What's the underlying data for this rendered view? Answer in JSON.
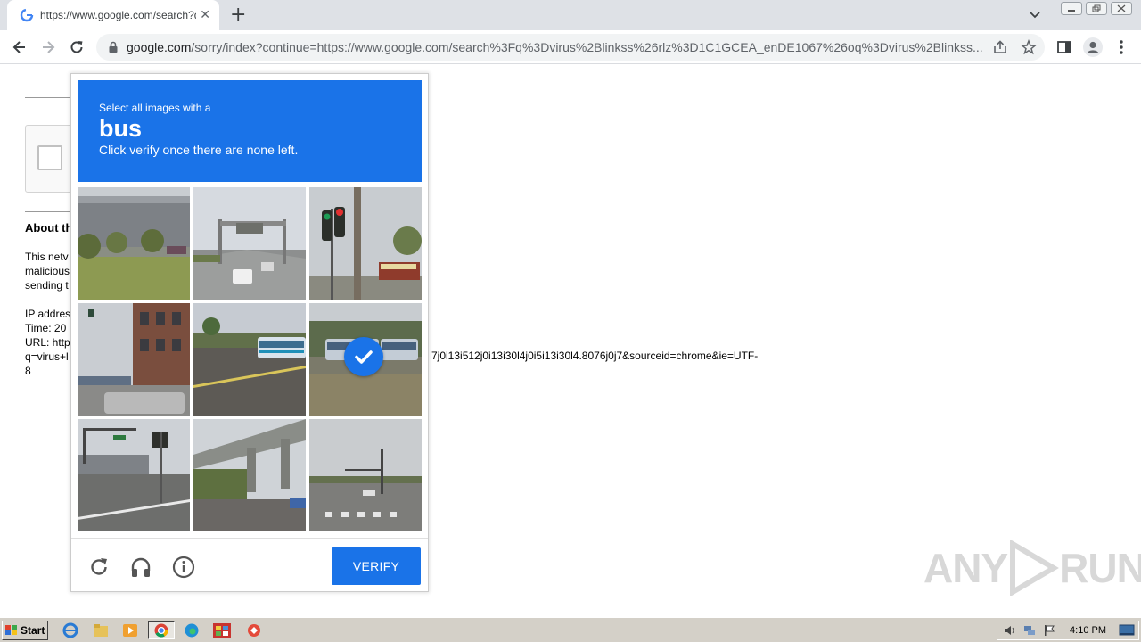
{
  "browser": {
    "tab_title": "https://www.google.com/search?q=",
    "tab_close": "✕",
    "new_tab": "+",
    "url_host": "google.com",
    "url_rest": "/sorry/index?continue=https://www.google.com/search%3Fq%3Dvirus%2Blinkss%26rlz%3D1C1GCEA_enDE1067%26oq%3Dvirus%2Blinkss..."
  },
  "page": {
    "about_heading": "About th",
    "paragraph_lines": [
      "This netv",
      "malicious",
      "sending t"
    ],
    "info_lines": [
      "IP addres",
      "Time: 20",
      "URL: http",
      "q=virus+l",
      "8"
    ],
    "url_tail": "7j0i13i512j0i13i30l4j0i5i13i30l4.8076j0j7&sourceid=chrome&ie=UTF-"
  },
  "captcha": {
    "header_sub": "Select all images with a",
    "target": "bus",
    "instruction": "Click verify once there are none left.",
    "tiles": [
      {
        "desc": "warehouse building with trees",
        "selected": false
      },
      {
        "desc": "highway with overhead sign",
        "selected": false
      },
      {
        "desc": "traffic light on pole",
        "selected": false
      },
      {
        "desc": "brick building with parked cars",
        "selected": false
      },
      {
        "desc": "bus on road",
        "selected": false
      },
      {
        "desc": "bus on road",
        "selected": true
      },
      {
        "desc": "intersection with traffic lights",
        "selected": false
      },
      {
        "desc": "overpass bridge",
        "selected": false
      },
      {
        "desc": "road intersection with crosswalk",
        "selected": false
      }
    ],
    "verify_label": "VERIFY",
    "footer_icons": [
      "reload-icon",
      "audio-headphones-icon",
      "info-icon"
    ]
  },
  "watermark": {
    "left": "ANY",
    "right": "RUN"
  },
  "taskbar": {
    "start_label": "Start",
    "clock": "4:10 PM"
  },
  "colors": {
    "accent": "#1a73e8",
    "taskbar": "#d4d0c8"
  }
}
